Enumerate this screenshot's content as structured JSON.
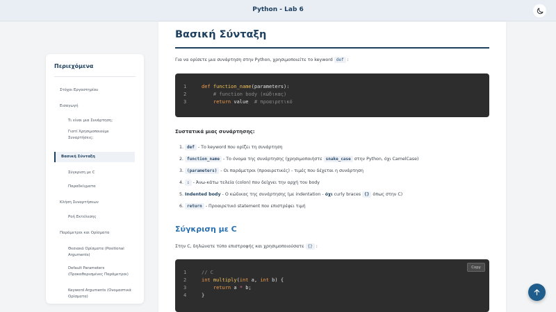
{
  "header": {
    "title": "Python - Lab 6",
    "theme_icon": "moon-icon"
  },
  "sidebar": {
    "title": "Περιεχόμενα",
    "items": [
      {
        "label": "Στόχοι Εργαστηρίου",
        "level": 1
      },
      {
        "label": "Εισαγωγή",
        "level": 1
      },
      {
        "label": "Τι είναι μια Συνάρτηση;",
        "level": 2
      },
      {
        "label": "Γιατί Χρησιμοποιούμε Συναρτήσεις;",
        "level": 2
      },
      {
        "label": "Βασική Σύνταξη",
        "level": 1,
        "active": true
      },
      {
        "label": "Σύγκριση με C",
        "level": 2
      },
      {
        "label": "Παραδείγματα",
        "level": 2
      },
      {
        "label": "Κλήση Συναρτήσεων",
        "level": 1
      },
      {
        "label": "Ροή Εκτέλεσης",
        "level": 2
      },
      {
        "label": "Παράμετροι και Ορίσματα",
        "level": 1
      },
      {
        "label": "Θεσιακά Ορίσματα (Positional Arguments)",
        "level": 2
      },
      {
        "label": "Default Parameters (Προκαθορισμένες Παράμετροι)",
        "level": 2
      },
      {
        "label": "Keyword Arguments (Ονομαστικά Ορίσματα)",
        "level": 2
      }
    ]
  },
  "main": {
    "title": "Βασική Σύνταξη",
    "intro": {
      "before": "Για να ορίσετε μια συνάρτηση στην Python, χρησιμοποιείτε το keyword",
      "code": "def",
      "after": ":"
    },
    "code1": {
      "lines": [
        {
          "n": "1",
          "parts": [
            [
              "kw",
              "def "
            ],
            [
              "fn",
              "function_name"
            ],
            [
              "tx",
              "(parameters):"
            ]
          ]
        },
        {
          "n": "2",
          "parts": [
            [
              "tx",
              "    "
            ],
            [
              "cm",
              "# function body (κώδικας)"
            ]
          ]
        },
        {
          "n": "3",
          "parts": [
            [
              "tx",
              "    "
            ],
            [
              "kw",
              "return"
            ],
            [
              "tx",
              " value  "
            ],
            [
              "cm",
              "# προαιρετικό"
            ]
          ]
        }
      ]
    },
    "components_title": "Συστατικά μιας συνάρτησης:",
    "components": [
      {
        "num": "1.",
        "code": "def",
        "bold": "",
        "text": " - Το keyword που ορίζει τη συνάρτηση"
      },
      {
        "num": "2.",
        "code": "function_name",
        "bold": "",
        "text": " - Το όνομα της συνάρτησης (χρησιμοποιήστε",
        "code2": "snake_case",
        "text2": "στην Python, όχι CamelCase)"
      },
      {
        "num": "3.",
        "code": "(parameters)",
        "bold": "",
        "text": " - Οι παράμετροι (προαιρετικές) - τιμές που δέχεται η συνάρτηση"
      },
      {
        "num": "4.",
        "code": ":",
        "bold": "",
        "text": " - Άνω-κάτω τελεία (colon) που δείχνει την αρχή του body"
      },
      {
        "num": "5.",
        "code": "",
        "bold": "Indented body",
        "text": " - Ο κώδικας της συνάρτησης (με indentation -",
        "bold2": "όχι",
        "text2": "curly braces",
        "code2": "{}",
        "text3": "όπως στην C)"
      },
      {
        "num": "6.",
        "code": "return",
        "bold": "",
        "text": " - Προαιρετικό statement που επιστρέφει τιμή"
      }
    ],
    "section2_title": "Σύγκριση με C",
    "section2_intro": {
      "before": "Στην C, δηλώνατε τύπο επιστροφής και χρησιμοποιούσατε",
      "code": "{}",
      "after": ":"
    },
    "code2": {
      "copy_label": "Copy",
      "lines": [
        {
          "n": "1",
          "parts": [
            [
              "cm",
              "// C"
            ]
          ]
        },
        {
          "n": "2",
          "parts": [
            [
              "kw",
              "int "
            ],
            [
              "fn",
              "multiply"
            ],
            [
              "tx",
              "("
            ],
            [
              "kw",
              "int"
            ],
            [
              "tx",
              " a, "
            ],
            [
              "kw",
              "int"
            ],
            [
              "tx",
              " b) {"
            ]
          ]
        },
        {
          "n": "3",
          "parts": [
            [
              "tx",
              "    "
            ],
            [
              "kw",
              "return"
            ],
            [
              "tx",
              " a "
            ],
            [
              "op",
              "*"
            ],
            [
              "tx",
              " b;"
            ]
          ]
        },
        {
          "n": "4",
          "parts": [
            [
              "tx",
              "}"
            ]
          ]
        }
      ]
    }
  },
  "fab": {
    "icon": "arrow-up-icon"
  },
  "colors": {
    "accent": "#1d3f5e",
    "link": "#2a6fb0",
    "code_bg": "#2d2d2d"
  }
}
